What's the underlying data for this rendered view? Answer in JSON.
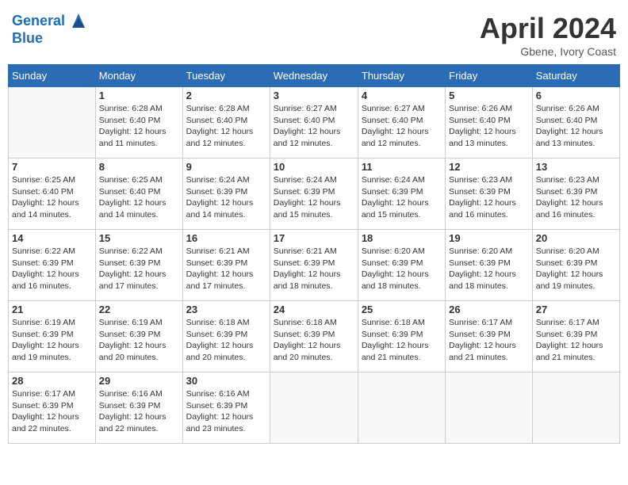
{
  "header": {
    "logo_line1": "General",
    "logo_line2": "Blue",
    "month_title": "April 2024",
    "location": "Gbene, Ivory Coast"
  },
  "weekdays": [
    "Sunday",
    "Monday",
    "Tuesday",
    "Wednesday",
    "Thursday",
    "Friday",
    "Saturday"
  ],
  "weeks": [
    [
      {
        "day": "",
        "info": ""
      },
      {
        "day": "1",
        "info": "Sunrise: 6:28 AM\nSunset: 6:40 PM\nDaylight: 12 hours\nand 11 minutes."
      },
      {
        "day": "2",
        "info": "Sunrise: 6:28 AM\nSunset: 6:40 PM\nDaylight: 12 hours\nand 12 minutes."
      },
      {
        "day": "3",
        "info": "Sunrise: 6:27 AM\nSunset: 6:40 PM\nDaylight: 12 hours\nand 12 minutes."
      },
      {
        "day": "4",
        "info": "Sunrise: 6:27 AM\nSunset: 6:40 PM\nDaylight: 12 hours\nand 12 minutes."
      },
      {
        "day": "5",
        "info": "Sunrise: 6:26 AM\nSunset: 6:40 PM\nDaylight: 12 hours\nand 13 minutes."
      },
      {
        "day": "6",
        "info": "Sunrise: 6:26 AM\nSunset: 6:40 PM\nDaylight: 12 hours\nand 13 minutes."
      }
    ],
    [
      {
        "day": "7",
        "info": "Sunrise: 6:25 AM\nSunset: 6:40 PM\nDaylight: 12 hours\nand 14 minutes."
      },
      {
        "day": "8",
        "info": "Sunrise: 6:25 AM\nSunset: 6:40 PM\nDaylight: 12 hours\nand 14 minutes."
      },
      {
        "day": "9",
        "info": "Sunrise: 6:24 AM\nSunset: 6:39 PM\nDaylight: 12 hours\nand 14 minutes."
      },
      {
        "day": "10",
        "info": "Sunrise: 6:24 AM\nSunset: 6:39 PM\nDaylight: 12 hours\nand 15 minutes."
      },
      {
        "day": "11",
        "info": "Sunrise: 6:24 AM\nSunset: 6:39 PM\nDaylight: 12 hours\nand 15 minutes."
      },
      {
        "day": "12",
        "info": "Sunrise: 6:23 AM\nSunset: 6:39 PM\nDaylight: 12 hours\nand 16 minutes."
      },
      {
        "day": "13",
        "info": "Sunrise: 6:23 AM\nSunset: 6:39 PM\nDaylight: 12 hours\nand 16 minutes."
      }
    ],
    [
      {
        "day": "14",
        "info": "Sunrise: 6:22 AM\nSunset: 6:39 PM\nDaylight: 12 hours\nand 16 minutes."
      },
      {
        "day": "15",
        "info": "Sunrise: 6:22 AM\nSunset: 6:39 PM\nDaylight: 12 hours\nand 17 minutes."
      },
      {
        "day": "16",
        "info": "Sunrise: 6:21 AM\nSunset: 6:39 PM\nDaylight: 12 hours\nand 17 minutes."
      },
      {
        "day": "17",
        "info": "Sunrise: 6:21 AM\nSunset: 6:39 PM\nDaylight: 12 hours\nand 18 minutes."
      },
      {
        "day": "18",
        "info": "Sunrise: 6:20 AM\nSunset: 6:39 PM\nDaylight: 12 hours\nand 18 minutes."
      },
      {
        "day": "19",
        "info": "Sunrise: 6:20 AM\nSunset: 6:39 PM\nDaylight: 12 hours\nand 18 minutes."
      },
      {
        "day": "20",
        "info": "Sunrise: 6:20 AM\nSunset: 6:39 PM\nDaylight: 12 hours\nand 19 minutes."
      }
    ],
    [
      {
        "day": "21",
        "info": "Sunrise: 6:19 AM\nSunset: 6:39 PM\nDaylight: 12 hours\nand 19 minutes."
      },
      {
        "day": "22",
        "info": "Sunrise: 6:19 AM\nSunset: 6:39 PM\nDaylight: 12 hours\nand 20 minutes."
      },
      {
        "day": "23",
        "info": "Sunrise: 6:18 AM\nSunset: 6:39 PM\nDaylight: 12 hours\nand 20 minutes."
      },
      {
        "day": "24",
        "info": "Sunrise: 6:18 AM\nSunset: 6:39 PM\nDaylight: 12 hours\nand 20 minutes."
      },
      {
        "day": "25",
        "info": "Sunrise: 6:18 AM\nSunset: 6:39 PM\nDaylight: 12 hours\nand 21 minutes."
      },
      {
        "day": "26",
        "info": "Sunrise: 6:17 AM\nSunset: 6:39 PM\nDaylight: 12 hours\nand 21 minutes."
      },
      {
        "day": "27",
        "info": "Sunrise: 6:17 AM\nSunset: 6:39 PM\nDaylight: 12 hours\nand 21 minutes."
      }
    ],
    [
      {
        "day": "28",
        "info": "Sunrise: 6:17 AM\nSunset: 6:39 PM\nDaylight: 12 hours\nand 22 minutes."
      },
      {
        "day": "29",
        "info": "Sunrise: 6:16 AM\nSunset: 6:39 PM\nDaylight: 12 hours\nand 22 minutes."
      },
      {
        "day": "30",
        "info": "Sunrise: 6:16 AM\nSunset: 6:39 PM\nDaylight: 12 hours\nand 23 minutes."
      },
      {
        "day": "",
        "info": ""
      },
      {
        "day": "",
        "info": ""
      },
      {
        "day": "",
        "info": ""
      },
      {
        "day": "",
        "info": ""
      }
    ]
  ]
}
